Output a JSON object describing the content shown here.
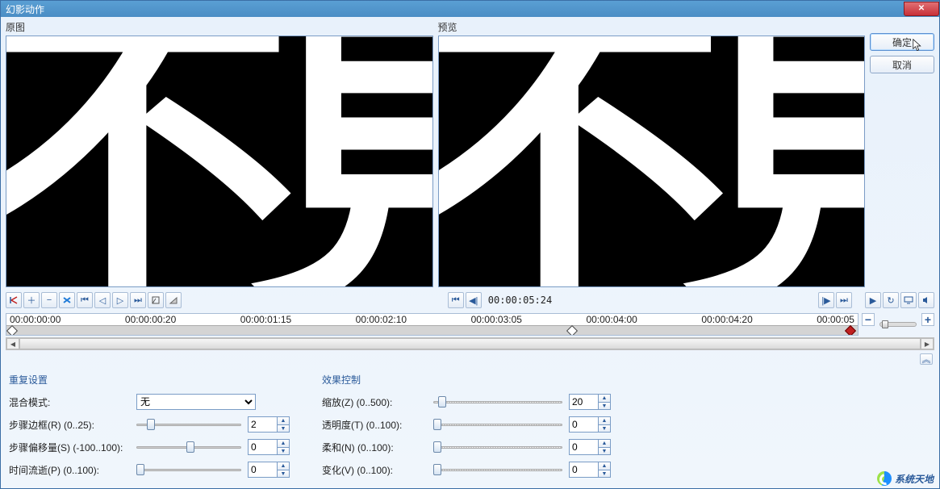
{
  "window": {
    "title": "幻影动作"
  },
  "labels": {
    "original": "原图",
    "preview": "预览"
  },
  "buttons": {
    "ok": "确定",
    "cancel": "取消"
  },
  "canvas": {
    "text": "不見"
  },
  "playback": {
    "timecode": "00:00:05:24"
  },
  "timeline": {
    "ticks": [
      "00:00:00:00",
      "00:00:00:20",
      "00:00:01:15",
      "00:00:02:10",
      "00:00:03:05",
      "00:00:04:00",
      "00:00:04:20",
      "00:00:05"
    ]
  },
  "sections": {
    "repeat": "重复设置",
    "effect": "效果控制"
  },
  "repeat": {
    "blend_label": "混合模式:",
    "blend_value": "无",
    "border_label": "步骤边框(R) (0..25):",
    "border_value": "2",
    "offset_label": "步骤偏移量(S) (-100..100):",
    "offset_value": "0",
    "time_label": "时间流逝(P) (0..100):",
    "time_value": "0"
  },
  "effect": {
    "zoom_label": "缩放(Z) (0..500):",
    "zoom_value": "20",
    "opacity_label": "透明度(T) (0..100):",
    "opacity_value": "0",
    "soft_label": "柔和(N) (0..100):",
    "soft_value": "0",
    "vary_label": "变化(V) (0..100):",
    "vary_value": "0"
  },
  "watermark": "系统天地",
  "icons": {
    "minus": "−",
    "plus": "+",
    "collapse": "⌃"
  }
}
